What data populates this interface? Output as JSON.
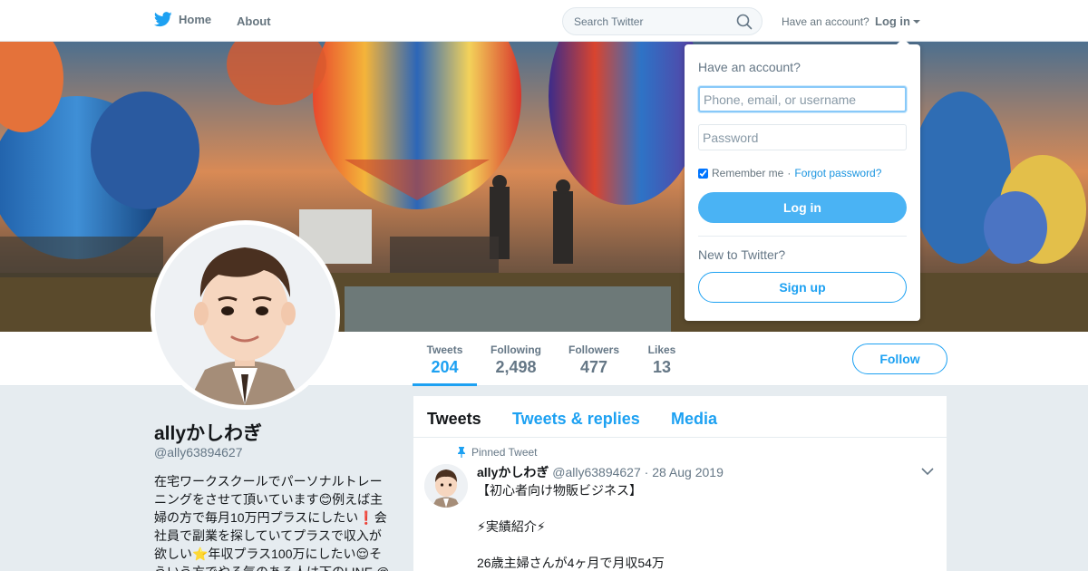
{
  "nav": {
    "home_label": "Home",
    "about_label": "About",
    "search_placeholder": "Search Twitter",
    "have_account": "Have an account?",
    "login_label": "Log in"
  },
  "profile": {
    "name": "allyかしわぎ",
    "handle": "@ally63894627",
    "bio": "在宅ワークスクールでパーソナルトレーニングをさせて頂いています😊例えば主婦の方で毎月10万円プラスにしたい❗会社員で副業を探していてプラスで収入が欲しい⭐年収プラス100万にしたい😌そういう方でやる気のある人は下のLINE @"
  },
  "stats": [
    {
      "label": "Tweets",
      "value": "204"
    },
    {
      "label": "Following",
      "value": "2,498"
    },
    {
      "label": "Followers",
      "value": "477"
    },
    {
      "label": "Likes",
      "value": "13"
    }
  ],
  "follow_label": "Follow",
  "timeline": {
    "tabs": [
      "Tweets",
      "Tweets & replies",
      "Media"
    ],
    "tweet": {
      "pinned_label": "Pinned Tweet",
      "name": "allyかしわぎ",
      "handle": "@ally63894627",
      "sep": "·",
      "date": "28 Aug 2019",
      "body": "【初心者向け物販ビジネス】\n\n⚡実績紹介⚡\n\n26歳主婦さんが4ヶ月で月収54万"
    }
  },
  "login_dropdown": {
    "title": "Have an account?",
    "username_placeholder": "Phone, email, or username",
    "password_placeholder": "Password",
    "remember_label": "Remember me",
    "sep": "·",
    "forgot_label": "Forgot password?",
    "login_button": "Log in",
    "new_label": "New to Twitter?",
    "signup_button": "Sign up"
  },
  "colors": {
    "accent": "#1da1f2",
    "background": "#e6ecf0"
  },
  "icons": [
    "twitter-bird-icon",
    "search-icon",
    "caret-down-icon",
    "pin-icon",
    "chevron-down-icon"
  ]
}
